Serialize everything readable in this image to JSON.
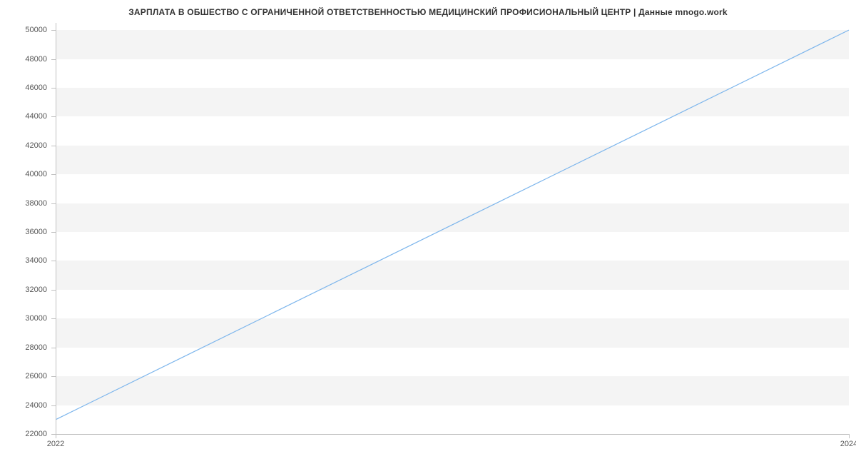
{
  "chart_data": {
    "type": "line",
    "title": "ЗАРПЛАТА В ОБШЕСТВО С ОГРАНИЧЕННОЙ ОТВЕТСТВЕННОСТЬЮ МЕДИЦИНСКИЙ ПРОФИСИОНАЛЬНЫЙ ЦЕНТР | Данные mnogo.work",
    "xlabel": "",
    "ylabel": "",
    "x": [
      2022,
      2024
    ],
    "values": [
      23000,
      50000
    ],
    "x_ticks": [
      2022,
      2024
    ],
    "y_ticks": [
      22000,
      24000,
      26000,
      28000,
      30000,
      32000,
      34000,
      36000,
      38000,
      40000,
      42000,
      44000,
      46000,
      48000,
      50000
    ],
    "xlim": [
      2022,
      2024
    ],
    "ylim": [
      22000,
      50500
    ],
    "line_color": "#7cb5ec",
    "grid_band_color": "#f4f4f4"
  }
}
